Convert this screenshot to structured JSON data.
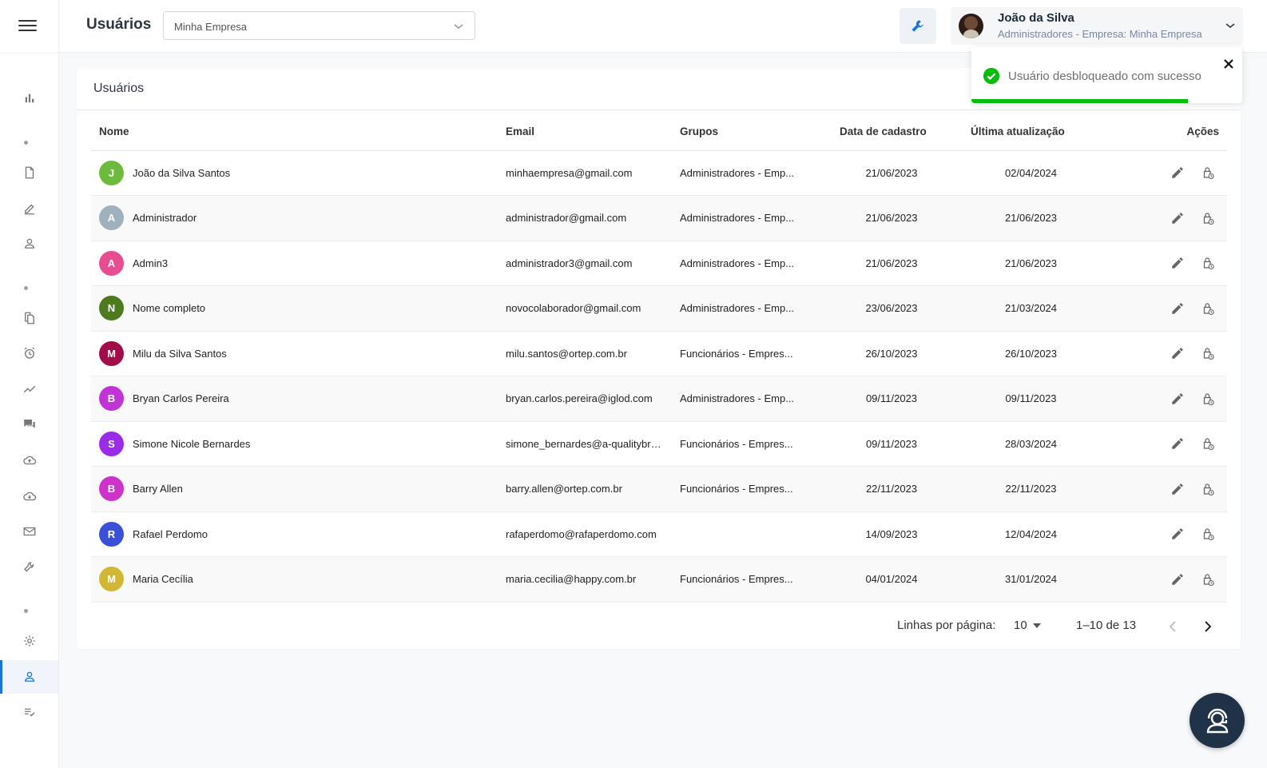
{
  "header": {
    "title": "Usuários",
    "company_select": {
      "value": "Minha Empresa",
      "options": [
        "Minha Empresa"
      ]
    },
    "user": {
      "name": "João da Silva",
      "role": "Administradores - Empresa: Minha Empresa"
    }
  },
  "sidebar": {
    "items": [
      {
        "icon": "bar-chart-icon"
      },
      {
        "icon": "document-icon"
      },
      {
        "icon": "edit-icon"
      },
      {
        "icon": "person-icon"
      },
      {
        "icon": "files-icon"
      },
      {
        "icon": "alarm-icon"
      },
      {
        "icon": "trending-icon"
      },
      {
        "icon": "chat-icon"
      },
      {
        "icon": "cloud-upload-icon"
      },
      {
        "icon": "cloud-download-icon"
      },
      {
        "icon": "mail-icon"
      },
      {
        "icon": "wrench-icon"
      },
      {
        "icon": "gear-icon"
      },
      {
        "icon": "users-icon",
        "active": true
      },
      {
        "icon": "checklist-icon"
      }
    ]
  },
  "card": {
    "title": "Usuários"
  },
  "table": {
    "columns": [
      "Nome",
      "Email",
      "Grupos",
      "Data de cadastro",
      "Última atualização",
      "Ações"
    ],
    "rows": [
      {
        "initial": "J",
        "color": "#6dbb3c",
        "name": "João da Silva Santos",
        "email": "minhaempresa@gmail.com",
        "group": "Administradores - Emp...",
        "created": "21/06/2023",
        "updated": "02/04/2024"
      },
      {
        "initial": "A",
        "color": "#9eb1bc",
        "name": "Administrador",
        "email": "administrador@gmail.com",
        "group": "Administradores - Emp...",
        "created": "21/06/2023",
        "updated": "21/06/2023"
      },
      {
        "initial": "A",
        "color": "#e84c91",
        "name": "Admin3",
        "email": "administrador3@gmail.com",
        "group": "Administradores - Emp...",
        "created": "21/06/2023",
        "updated": "21/06/2023"
      },
      {
        "initial": "N",
        "color": "#4c7a1e",
        "name": "Nome completo",
        "email": "novocolaborador@gmail.com",
        "group": "Administradores - Emp...",
        "created": "23/06/2023",
        "updated": "21/03/2024"
      },
      {
        "initial": "M",
        "color": "#a00d4a",
        "name": "Milu da Silva Santos",
        "email": "milu.santos@ortep.com.br",
        "group": "Funcionários - Empres...",
        "created": "26/10/2023",
        "updated": "26/10/2023"
      },
      {
        "initial": "B",
        "color": "#c034d6",
        "name": "Bryan Carlos Pereira",
        "email": "bryan.carlos.pereira@iglod.com",
        "group": "Administradores - Emp...",
        "created": "09/11/2023",
        "updated": "09/11/2023"
      },
      {
        "initial": "S",
        "color": "#9a2be6",
        "name": "Simone Nicole Bernardes",
        "email": "simone_bernardes@a-qualitybrasil",
        "group": "Funcionários - Empres...",
        "created": "09/11/2023",
        "updated": "28/03/2024"
      },
      {
        "initial": "B",
        "color": "#cb33c9",
        "name": "Barry Allen",
        "email": "barry.allen@ortep.com.br",
        "group": "Funcionários - Empres...",
        "created": "22/11/2023",
        "updated": "22/11/2023"
      },
      {
        "initial": "R",
        "color": "#3b50d9",
        "name": "Rafael Perdomo",
        "email": "rafaperdomo@rafaperdomo.com",
        "group": "",
        "created": "14/09/2023",
        "updated": "12/04/2024"
      },
      {
        "initial": "M",
        "color": "#d1b733",
        "name": "Maria Cecília",
        "email": "maria.cecilia@happy.com.br",
        "group": "Funcionários - Empres...",
        "created": "04/01/2024",
        "updated": "31/01/2024"
      }
    ]
  },
  "pagination": {
    "rows_label": "Linhas por página:",
    "rows_per_page": "10",
    "range": "1–10 de 13"
  },
  "toast": {
    "message": "Usuário desbloqueado com sucesso",
    "progress": 0.8
  },
  "colors": {
    "accent": "#1976d2",
    "success": "#07bc0c",
    "fab": "#1f3248"
  }
}
